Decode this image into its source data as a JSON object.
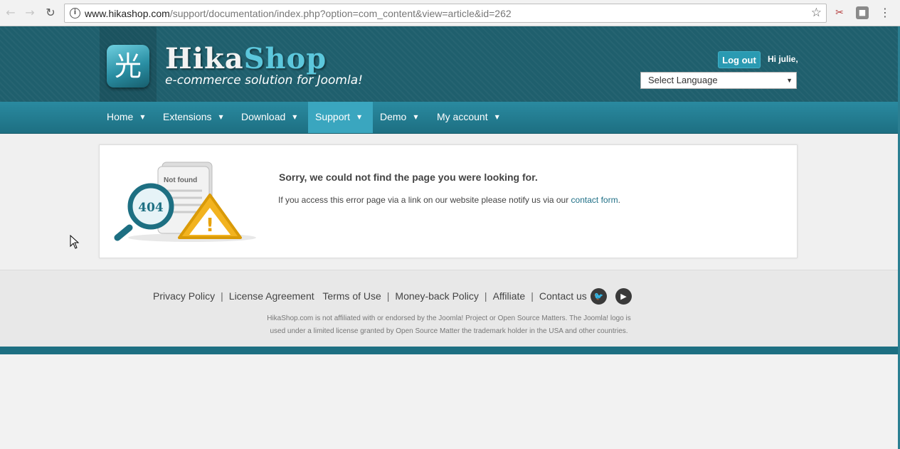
{
  "browser": {
    "url_host": "www.hikashop.com",
    "url_path": "/support/documentation/index.php?option=com_content&view=article&id=262",
    "icons": [
      "back-arrow-icon",
      "forward-arrow-icon",
      "reload-icon",
      "info-icon",
      "star-icon",
      "extension-icon",
      "extension-icon",
      "menu-dots-icon"
    ]
  },
  "header": {
    "logo_hika": "Hika",
    "logo_shop": "Shop",
    "tagline": "e-commerce solution for Joomla!",
    "logo_glyph": "光",
    "logout_label": "Log out",
    "greeting": "Hi julie,",
    "language_select": "Select Language"
  },
  "menu": {
    "items": [
      {
        "label": "Home",
        "active": false
      },
      {
        "label": "Extensions",
        "active": false
      },
      {
        "label": "Download",
        "active": false
      },
      {
        "label": "Support",
        "active": true
      },
      {
        "label": "Demo",
        "active": false
      },
      {
        "label": "My account",
        "active": false
      }
    ]
  },
  "error": {
    "badge_text": "404",
    "doc_text": "Not found",
    "title": "Sorry, we could not find the page you were looking for.",
    "text_before": "If you access this error page via a link on our website please notify us via our ",
    "link_text": "contact form",
    "text_after": "."
  },
  "footer": {
    "links": [
      "Privacy Policy",
      "License Agreement",
      "Terms of Use",
      "Money-back Policy",
      "Affiliate",
      "Contact us"
    ],
    "disclaimer_line1": "HikaShop.com is not affiliated with or endorsed by the Joomla! Project or Open Source Matters. The Joomla! logo is",
    "disclaimer_line2": "used under a limited license granted by Open Source Matter the trademark holder in the USA and other countries."
  },
  "colors": {
    "header_bg": "#1f5f6d",
    "menu_bg": "#2a8aa0",
    "active_menu": "#3aa6bf",
    "accent": "#5cc7dc",
    "link": "#1f6f86"
  }
}
